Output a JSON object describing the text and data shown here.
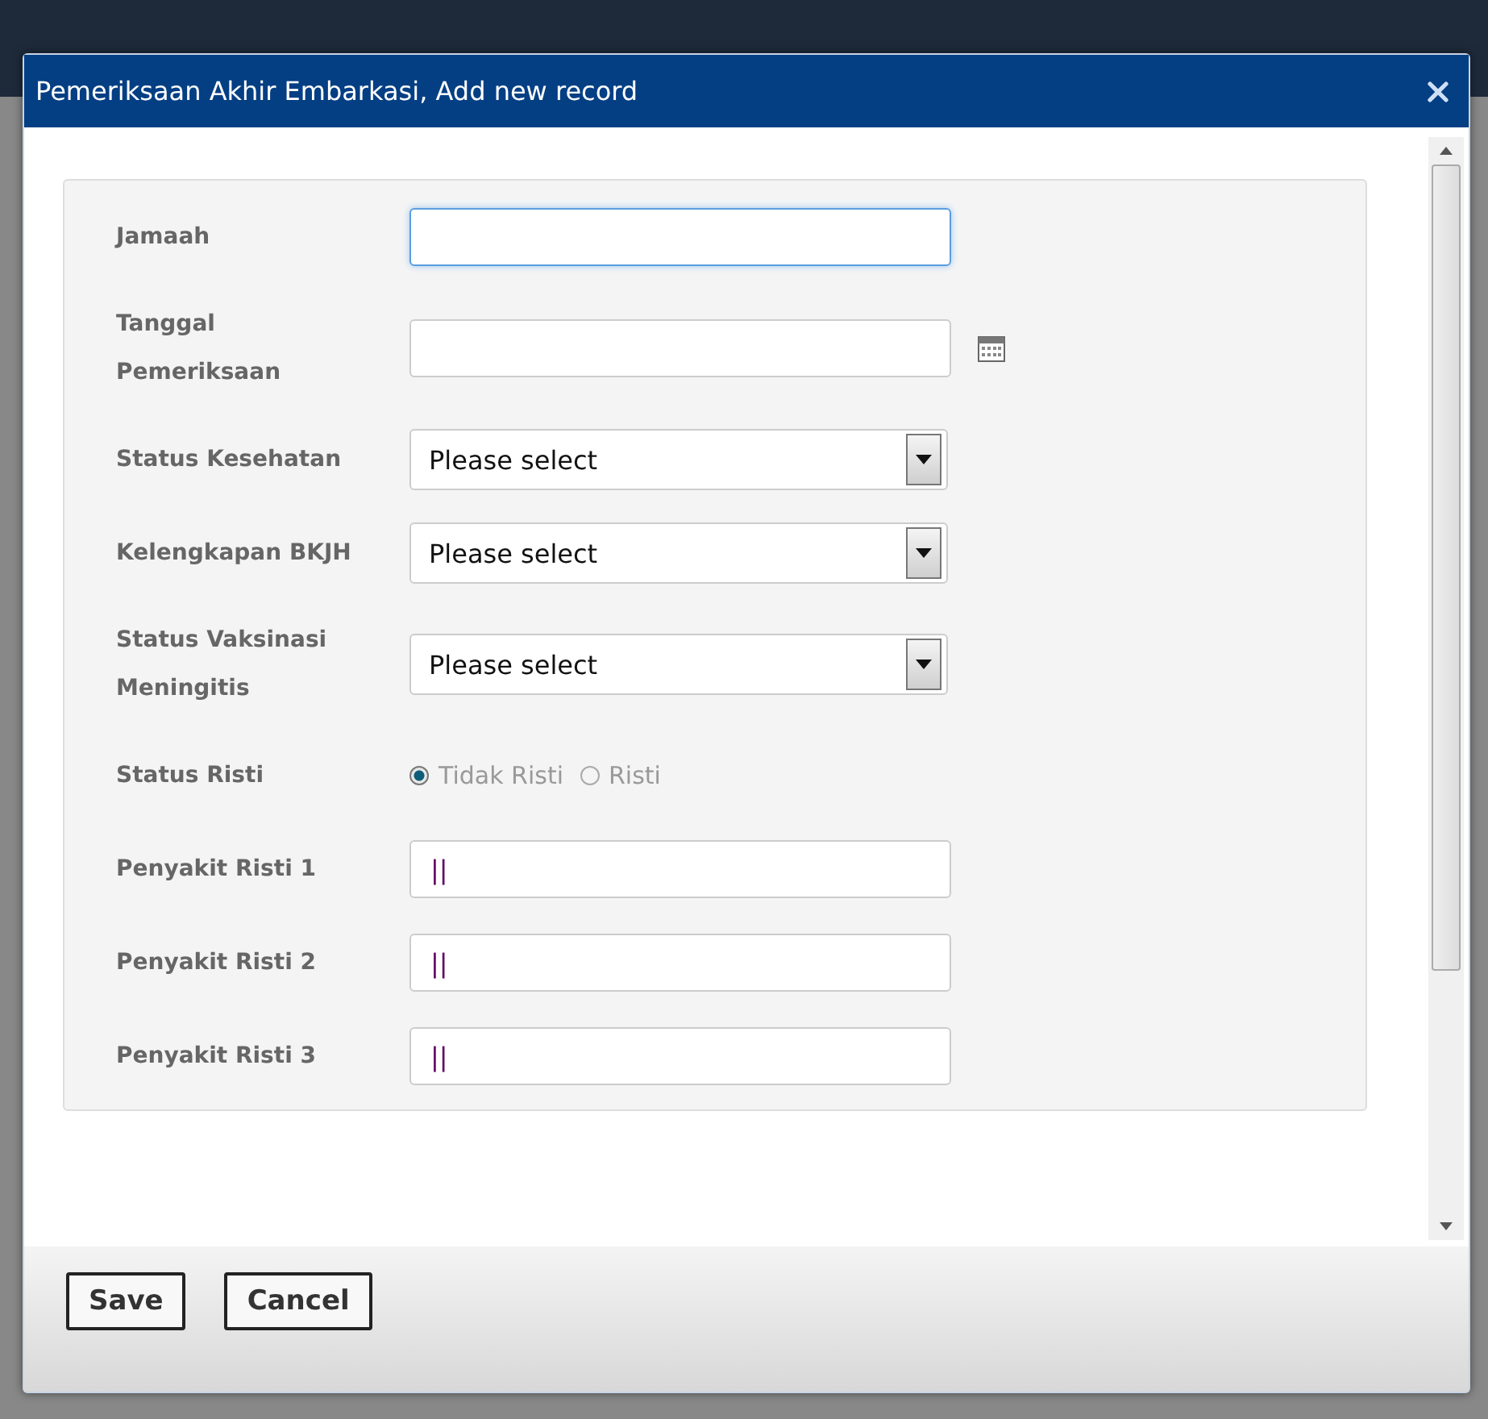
{
  "dialog": {
    "title": "Pemeriksaan Akhir Embarkasi, Add new record"
  },
  "fields": [
    {
      "kind": "text",
      "label": "Jamaah",
      "focused": true
    },
    {
      "kind": "date",
      "label": "Tanggal Pemeriksaan",
      "focused": false
    },
    {
      "kind": "select",
      "label": "Status Kesehatan",
      "value": "Please select"
    },
    {
      "kind": "select",
      "label": "Kelengkapan BKJH",
      "value": "Please select"
    },
    {
      "kind": "select",
      "label": "Status Vaksinasi Meningitis",
      "value": "Please select"
    },
    {
      "kind": "radio",
      "label": "Status Risti",
      "options": [
        {
          "label": "Tidak Risti",
          "selected": true
        },
        {
          "label": "Risti",
          "selected": false
        }
      ]
    },
    {
      "kind": "text",
      "label": "Penyakit Risti 1",
      "value": "||",
      "focused": false
    },
    {
      "kind": "text",
      "label": "Penyakit Risti 2",
      "value": "||",
      "focused": false
    },
    {
      "kind": "text",
      "label": "Penyakit Risti 3",
      "value": "||",
      "focused": false
    }
  ],
  "buttons": [
    "Save",
    "Cancel"
  ]
}
